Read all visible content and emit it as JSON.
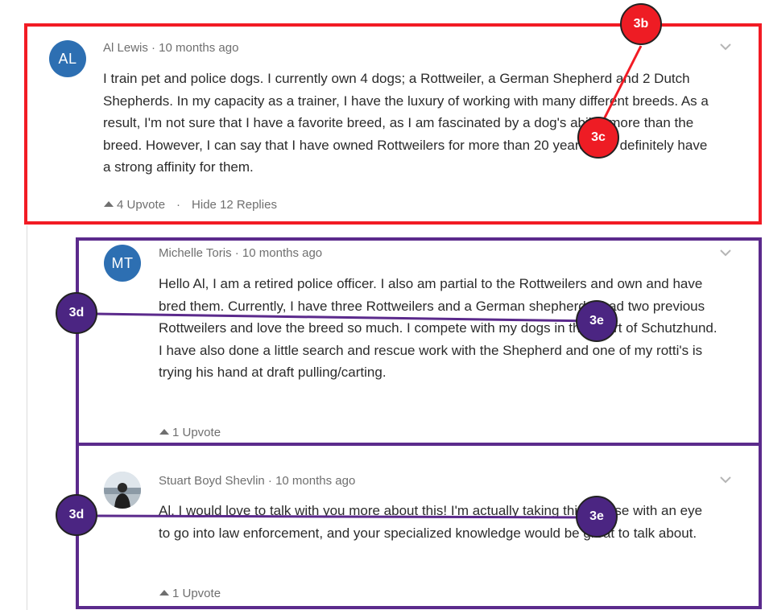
{
  "comments": [
    {
      "initials": "AL",
      "avatar_color": "#2d6fb2",
      "meta": "Al Lewis · 10 months ago",
      "body": "I train pet and police dogs. I currently own 4 dogs; a Rottweiler, a German Shepherd and 2 Dutch Shepherds. In my capacity as a trainer, I have the luxury of working with many different breeds. As a result, I'm not sure that I have a favorite breed, as I am fascinated by a dog's ability more than the breed. However, I can say that I have owned Rottweilers for more than 20 years, so I definitely have a strong affinity for them.",
      "upvote": "4 Upvote",
      "replies": "Hide 12 Replies"
    },
    {
      "initials": "MT",
      "avatar_color": "#2d6fb2",
      "meta": "Michelle Toris · 10 months ago",
      "body": "Hello Al, I am a retired police officer. I also am partial to the Rottweilers and own and have bred them. Currently, I have three Rottweilers and a German shepherd. I had two previous Rottweilers and love the breed so much. I compete with my dogs in the sport of Schutzhund. I have also done a little search and rescue work with the Shepherd and one of my rotti's is trying his hand at draft pulling/carting.",
      "upvote": "1 Upvote"
    },
    {
      "meta": "Stuart Boyd Shevlin · 10 months ago",
      "body": "Al, I would love to talk with you more about this! I'm actually taking this course with an eye to go into law enforcement, and your specialized knowledge would be great to talk about.",
      "upvote": "1 Upvote"
    }
  ],
  "annotations": {
    "badges": [
      "3b",
      "3c",
      "3d",
      "3e",
      "3d",
      "3e"
    ],
    "red": "#f21b24",
    "purple": "#5b2a8c"
  }
}
